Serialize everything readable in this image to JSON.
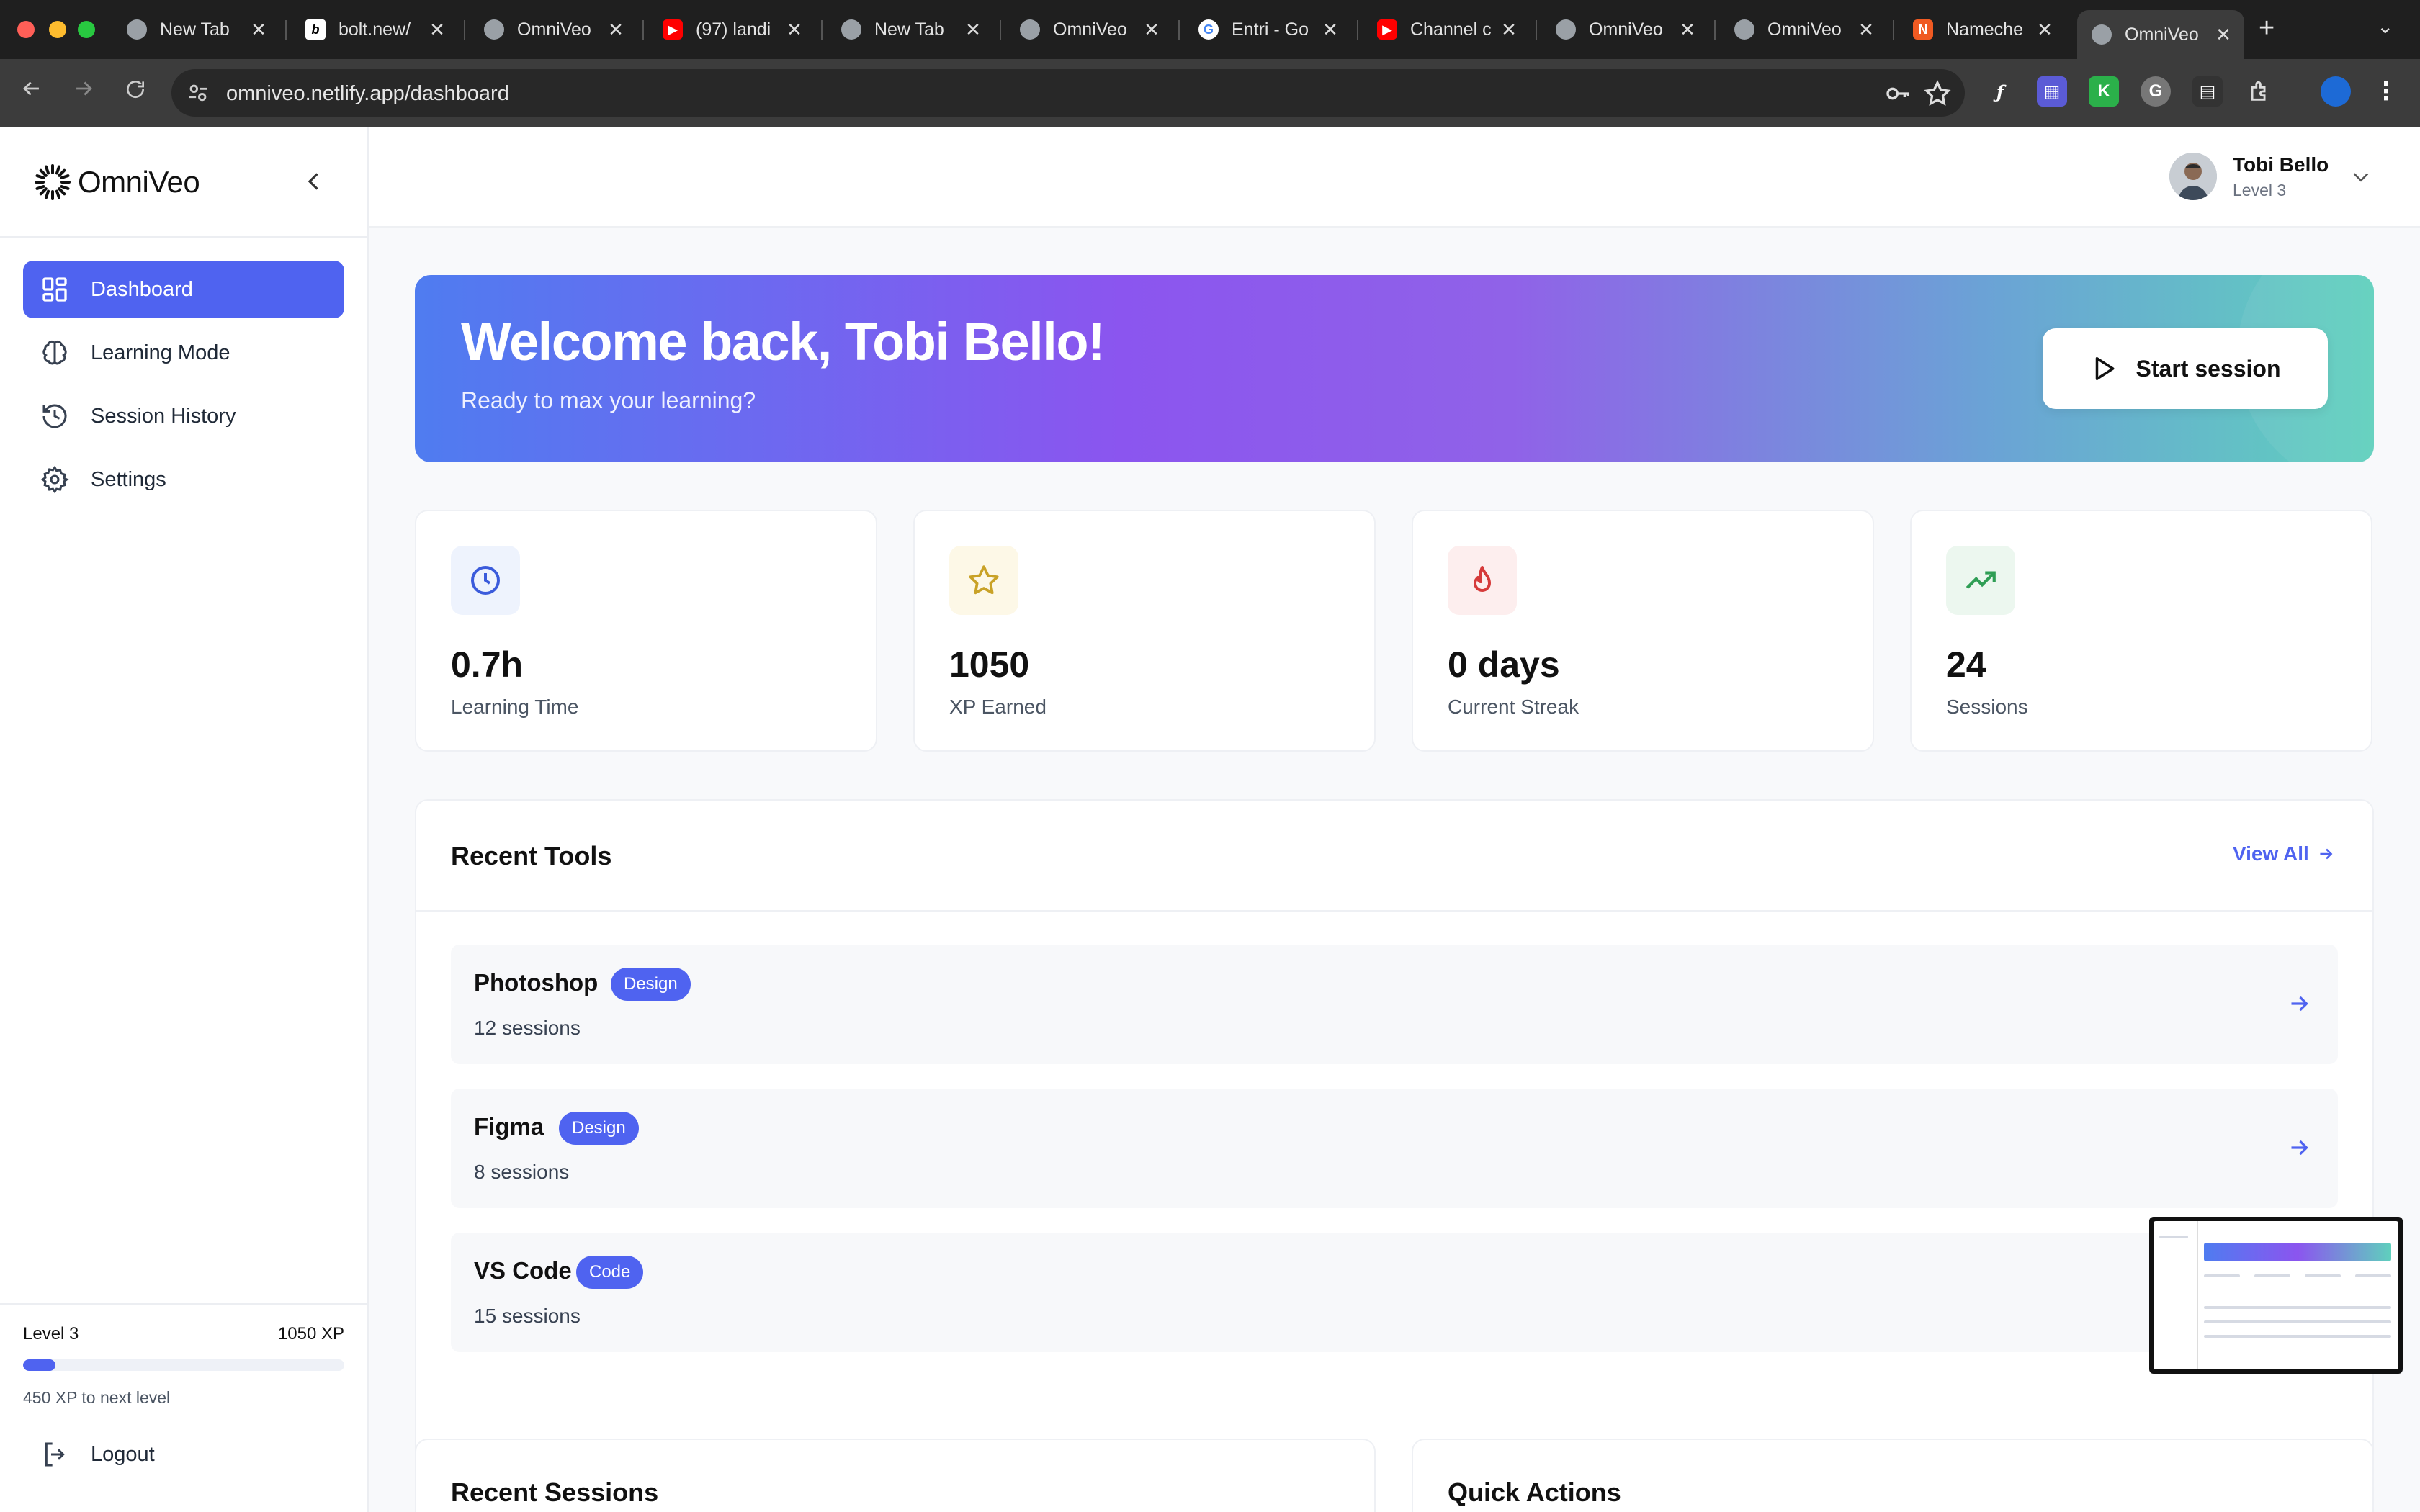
{
  "browser": {
    "tabs": [
      {
        "title": "New Tab",
        "icon": "chrome-icon",
        "fav_color": "#5f6368"
      },
      {
        "title": "bolt.new/",
        "icon": "bolt-icon",
        "fav_color": "#000000"
      },
      {
        "title": "OmniVeo",
        "icon": "globe-icon",
        "fav_color": "#5f6368"
      },
      {
        "title": "(97) landi",
        "icon": "youtube-icon",
        "fav_color": "#ff0000"
      },
      {
        "title": "New Tab",
        "icon": "chrome-icon",
        "fav_color": "#5f6368"
      },
      {
        "title": "OmniVeo",
        "icon": "globe-icon",
        "fav_color": "#5f6368"
      },
      {
        "title": "Entri - Go",
        "icon": "google-icon",
        "fav_color": "#ffffff"
      },
      {
        "title": "Channel c",
        "icon": "youtube-icon",
        "fav_color": "#ff0000"
      },
      {
        "title": "OmniVeo",
        "icon": "globe-icon",
        "fav_color": "#5f6368"
      },
      {
        "title": "OmniVeo",
        "icon": "globe-icon",
        "fav_color": "#5f6368"
      },
      {
        "title": "Nameche",
        "icon": "namecheap-icon",
        "fav_color": "#f05a22"
      },
      {
        "title": "OmniVeo",
        "icon": "globe-icon",
        "fav_color": "#5f6368"
      }
    ],
    "url": "omniveo.netlify.app/dashboard"
  },
  "brand": {
    "name": "OmniVeo",
    "accent": "#4f63f0"
  },
  "sidebar": {
    "items": [
      {
        "label": "Dashboard",
        "icon": "dashboard-grid-icon"
      },
      {
        "label": "Learning Mode",
        "icon": "brain-icon"
      },
      {
        "label": "Session History",
        "icon": "history-icon"
      },
      {
        "label": "Settings",
        "icon": "gear-icon"
      }
    ],
    "level": "Level 3",
    "xp": "1050 XP",
    "xp_progress": 0.1,
    "xp_next": "450 XP to next level",
    "logout": "Logout"
  },
  "user": {
    "name": "Tobi Bello",
    "level": "Level 3"
  },
  "hero": {
    "title": "Welcome back, Tobi Bello!",
    "subtitle": "Ready to max your learning?",
    "button": "Start session"
  },
  "stats": [
    {
      "value": "0.7h",
      "label": "Learning Time",
      "icon": "clock-icon",
      "color": "#3b5bdb",
      "bg": "#eef3fd"
    },
    {
      "value": "1050",
      "label": "XP Earned",
      "icon": "star-icon",
      "color": "#c9a227",
      "bg": "#fdf8e7"
    },
    {
      "value": "0 days",
      "label": "Current Streak",
      "icon": "flame-icon",
      "color": "#d63a3a",
      "bg": "#fdeeee"
    },
    {
      "value": "24",
      "label": "Sessions",
      "icon": "trending-up-icon",
      "color": "#2f9e55",
      "bg": "#ecf7ef"
    }
  ],
  "recent_tools": {
    "title": "Recent Tools",
    "view_all": "View All",
    "items": [
      {
        "name": "Photoshop",
        "badge": "Design",
        "sessions": "12 sessions"
      },
      {
        "name": "Figma",
        "badge": "Design",
        "sessions": "8 sessions"
      },
      {
        "name": "VS Code",
        "badge": "Code",
        "sessions": "15 sessions"
      }
    ]
  },
  "recent_sessions": {
    "title": "Recent Sessions"
  },
  "quick_actions": {
    "title": "Quick Actions"
  }
}
